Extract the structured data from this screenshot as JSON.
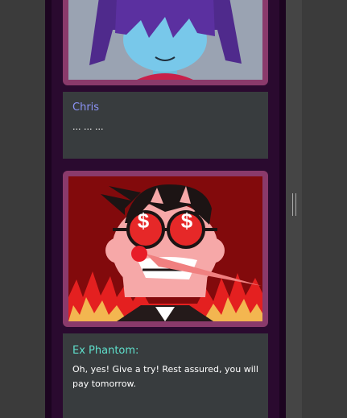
{
  "dialogs": [
    {
      "speaker": "Chris",
      "speaker_color": "#8b93f6",
      "text": "··· ··· ···"
    },
    {
      "speaker": "Ex Phantom:",
      "speaker_color": "#5fe0cc",
      "text": "Oh, yes! Give a try! Rest assured, you will pay tomorrow."
    }
  ],
  "portraits": [
    {
      "icon": "character-portrait-chris"
    },
    {
      "icon": "character-portrait-ex-phantom",
      "eye_symbol": "$"
    }
  ]
}
